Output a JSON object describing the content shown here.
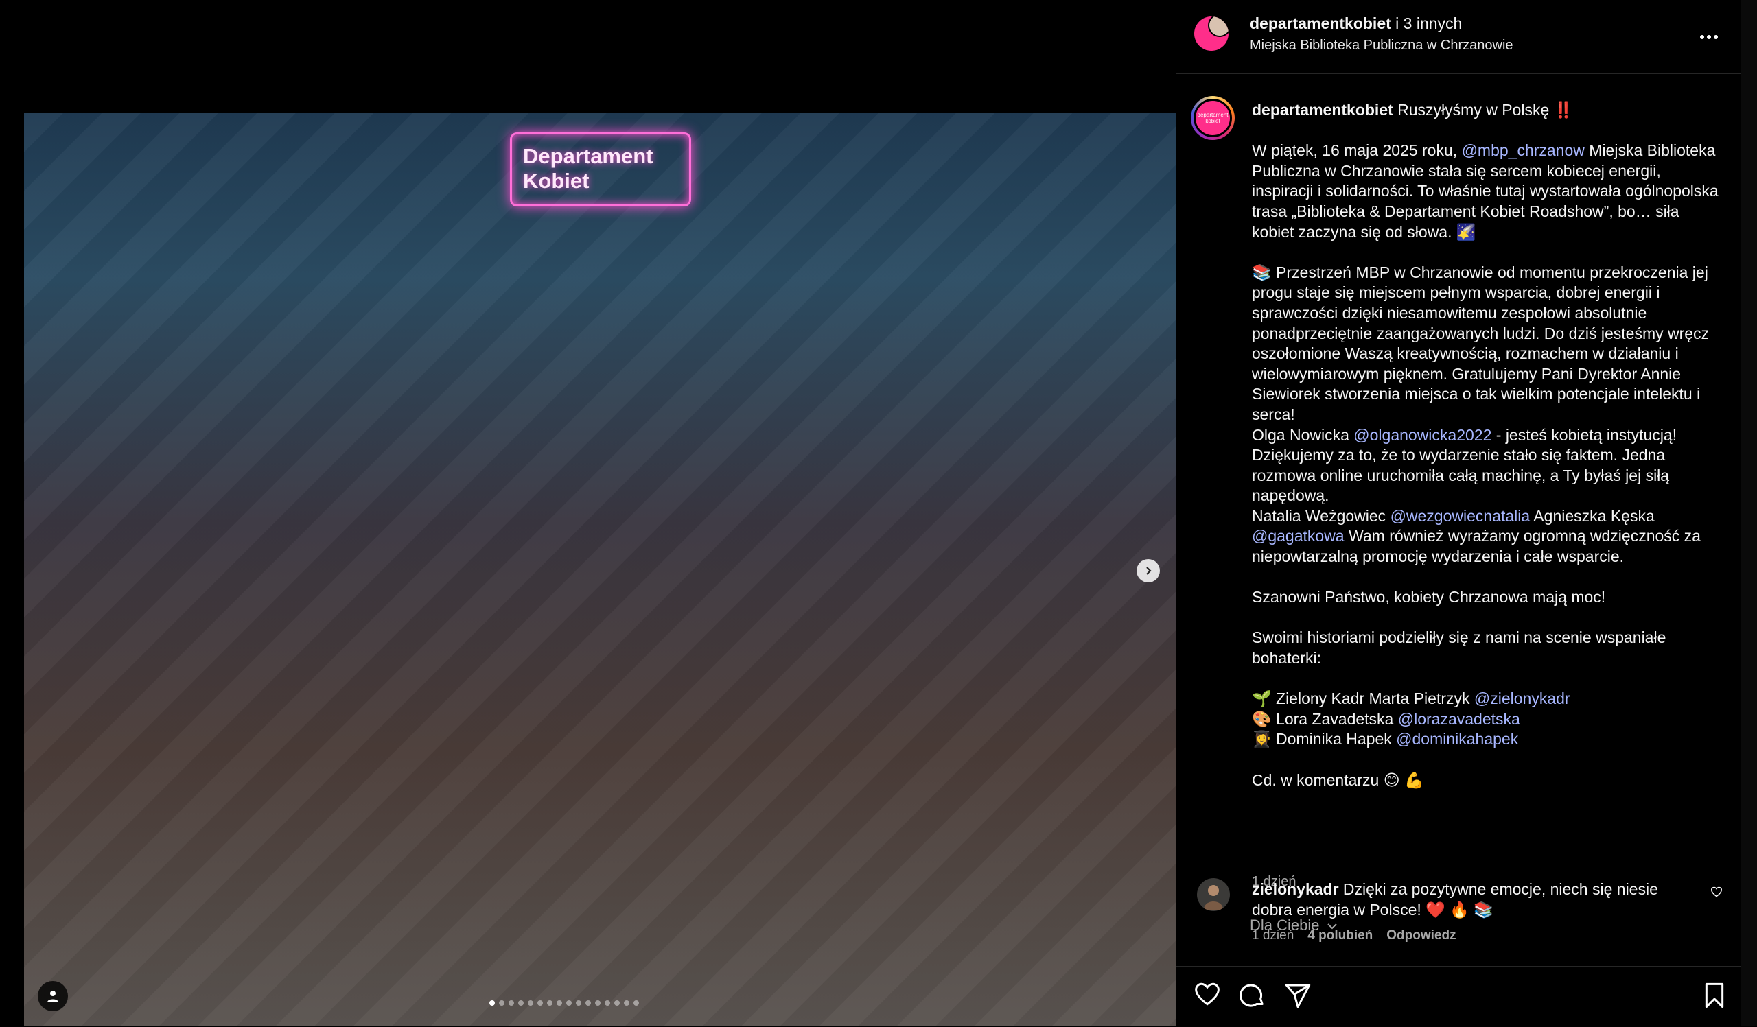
{
  "header": {
    "username": "departamentkobiet",
    "coauthors": " i 3 innych",
    "location": "Miejska Biblioteka Publiczna w Chrzanowie",
    "more_icon": "more-horizontal-icon"
  },
  "media": {
    "neon_line1": "Departament",
    "neon_line2": "Kobiet",
    "slide_count": 16,
    "active_slide": 1,
    "next_icon": "chevron-right-icon",
    "tag_icon": "user-tag-icon"
  },
  "post": {
    "author": "departamentkobiet",
    "avatar_text": "departament kobiet",
    "title": " Ruszyłyśmy w Polskę ‼️",
    "p1_a": "W piątek, 16 maja 2025 roku, ",
    "p1_mention": "@mbp_chrzanow",
    "p1_b": " Miejska Biblioteka Publiczna w Chrzanowie stała się sercem kobiecej energii, inspiracji i solidarności. To właśnie tutaj wystartowała ogólnopolska trasa „Biblioteka & Departament Kobiet Roadshow”, bo… siła kobiet zaczyna się od słowa. 🌠",
    "p2": "📚 Przestrzeń MBP w Chrzanowie od momentu przekroczenia jej progu staje się miejscem pełnym wsparcia, dobrej energii i sprawczości dzięki niesamowitemu zespołowi absolutnie ponadprzeciętnie zaangażowanych ludzi. Do dziś jesteśmy wręcz oszołomione Waszą kreatywnością, rozmachem w działaniu i wielowymiarowym pięknem. Gratulujemy Pani Dyrektor Annie Siewiorek stworzenia miejsca o tak wielkim potencjale intelektu i serca!",
    "p3_a": "Olga Nowicka ",
    "p3_mention": "@olganowicka2022",
    "p3_b": " - jesteś kobietą instytucją! Dziękujemy za to, że to wydarzenie stało się faktem. Jedna rozmowa online uruchomiła całą machinę, a Ty byłaś jej siłą napędową.",
    "p4_a": "Natalia Weżgowiec ",
    "p4_mention1": "@wezgowiecnatalia",
    "p4_b": " Agnieszka Kęska ",
    "p4_mention2": "@gagatkowa",
    "p4_c": " Wam również wyrażamy ogromną wdzięczność za niepowtarzalną promocję wydarzenia i całe wsparcie.",
    "p5": "Szanowni Państwo, kobiety Chrzanowa mają moc!",
    "p6": "Swoimi historiami podzieliły się z nami na scenie wspaniałe bohaterki:",
    "h1_a": "🌱 Zielony Kadr Marta Pietrzyk ",
    "h1_mention": "@zielonykadr",
    "h2_a": "🎨 Lora Zavadetska ",
    "h2_mention": "@lorazavadetska",
    "h3_a": "👩‍🎓 Dominika Hapek ",
    "h3_mention": "@dominikahapek",
    "p7": "Cd. w komentarzu 😊 💪",
    "time": "1 dzień"
  },
  "dla_ciebie": "Dla Ciebie",
  "comment": {
    "user": "zielonykadr",
    "text": " Dzięki za pozytywne emocje, niech się niesie dobra energia w Polsce! ❤️ 🔥 📚",
    "time": "1 dzień",
    "likes": "4 polubień",
    "reply": "Odpowiedz"
  },
  "actions": {
    "like_icon": "heart-icon",
    "comment_icon": "comment-icon",
    "share_icon": "send-icon",
    "save_icon": "bookmark-icon"
  }
}
